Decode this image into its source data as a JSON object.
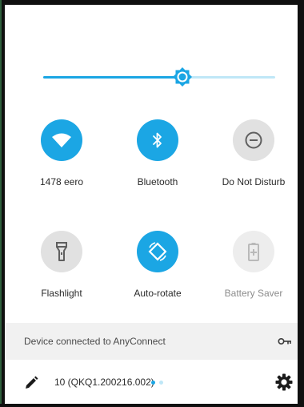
{
  "brightness": {
    "level_fraction": 0.6
  },
  "tiles": [
    {
      "id": "wifi",
      "label": "1478 eero",
      "icon": "wifi-icon",
      "state": "on"
    },
    {
      "id": "bluetooth",
      "label": "Bluetooth",
      "icon": "bluetooth-icon",
      "state": "on"
    },
    {
      "id": "dnd",
      "label": "Do Not Disturb",
      "icon": "do-not-disturb-icon",
      "state": "off"
    },
    {
      "id": "flashlight",
      "label": "Flashlight",
      "icon": "flashlight-icon",
      "state": "off"
    },
    {
      "id": "autorotate",
      "label": "Auto-rotate",
      "icon": "auto-rotate-icon",
      "state": "on"
    },
    {
      "id": "batterysaver",
      "label": "Battery Saver",
      "icon": "battery-saver-icon",
      "state": "disabled"
    }
  ],
  "footer": {
    "vpn_text": "Device connected to AnyConnect",
    "vpn_icon": "key-icon",
    "build_text": "10 (QKQ1.200216.002)",
    "edit_icon": "pencil-icon",
    "settings_icon": "gear-icon",
    "page_indicator": {
      "count": 2,
      "active_index": 0
    }
  },
  "colors": {
    "accent": "#1ba6e4",
    "accent_light": "#bfe7f7",
    "tile_off": "#e1e1e1",
    "tile_disabled": "#ededed",
    "footer_bg": "#f1f1f1"
  }
}
